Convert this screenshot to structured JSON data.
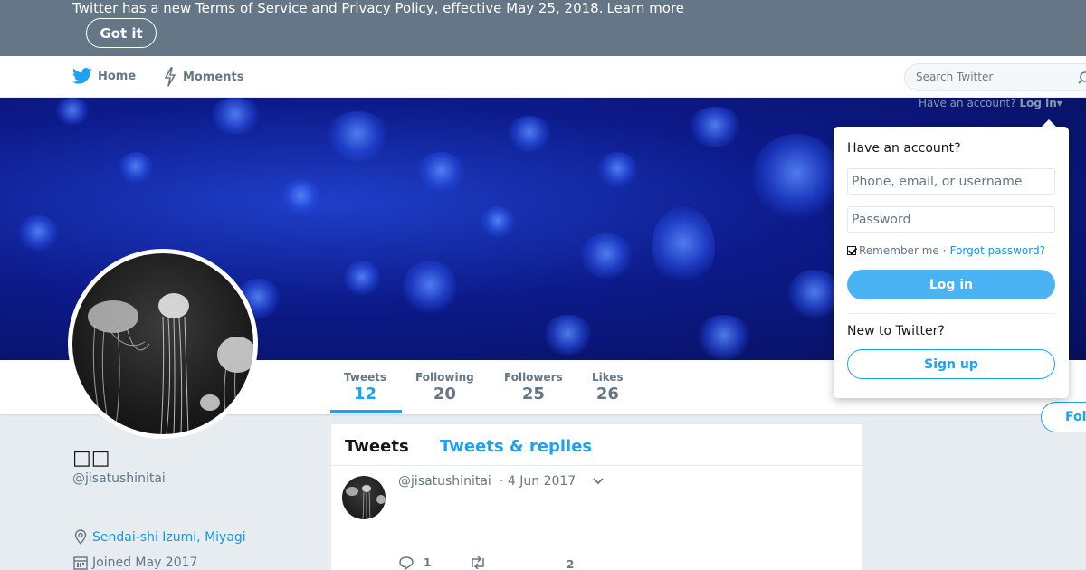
{
  "banner": {
    "text": "Twitter has a new Terms of Service and Privacy Policy, effective May 25, 2018.",
    "learn_more": "Learn more",
    "got_it": "Got it"
  },
  "nav": {
    "home": "Home",
    "moments": "Moments",
    "search_placeholder": "Search Twitter",
    "account_hint": "Have an account?",
    "login_link": "Log in"
  },
  "profile": {
    "display_name": "□□",
    "screen_name": "@jisatushinitai",
    "location": "Sendai-shi Izumi, Miyagi",
    "joined": "Joined May 2017",
    "follow_label": "Fol"
  },
  "stats": [
    {
      "label": "Tweets",
      "value": "12"
    },
    {
      "label": "Following",
      "value": "20"
    },
    {
      "label": "Followers",
      "value": "25"
    },
    {
      "label": "Likes",
      "value": "26"
    }
  ],
  "timeline": {
    "tabs": [
      "Tweets",
      "Tweets & replies"
    ],
    "tweet": {
      "handle": "@jisatushinitai",
      "time": "· 4 Jun 2017",
      "reply_count": "1",
      "like_count": "2"
    }
  },
  "login_panel": {
    "title": "Have an account?",
    "username_placeholder": "Phone, email, or username",
    "password_placeholder": "Password",
    "remember": "Remember me",
    "separator": "·",
    "forgot": "Forgot password?",
    "login_button": "Log in",
    "new_to_twitter": "New to Twitter?",
    "signup_button": "Sign up"
  },
  "colors": {
    "twitter_blue": "#1da1f2",
    "banner_gray": "#657786",
    "login_button": "#4ab3f4"
  },
  "icons": [
    "twitter-bird-icon",
    "lightning-icon",
    "search-icon",
    "caret-down-icon",
    "location-pin-icon",
    "calendar-icon",
    "reply-icon",
    "retweet-icon",
    "chevron-down-icon"
  ]
}
